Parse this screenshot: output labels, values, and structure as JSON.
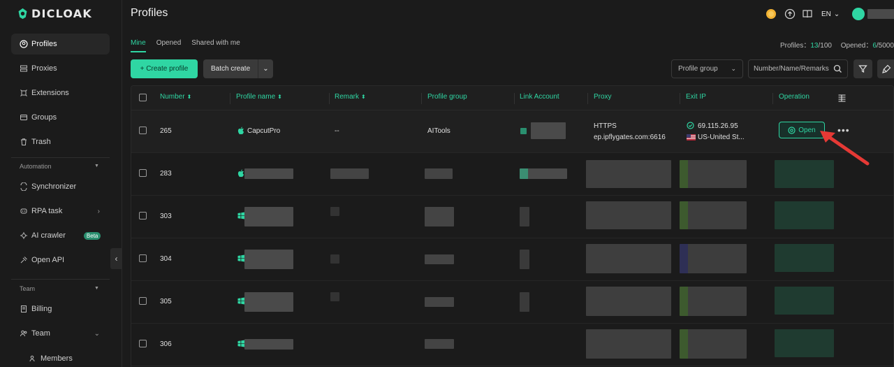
{
  "app": {
    "logo_text": "DICLOAK",
    "page_title": "Profiles"
  },
  "colors": {
    "accent": "#2fd6a3",
    "background": "#1b1b1b",
    "arrow": "#e53935"
  },
  "sidebar": {
    "items": [
      {
        "label": "Profiles",
        "icon": "profile-icon",
        "active": true
      },
      {
        "label": "Proxies",
        "icon": "proxy-icon"
      },
      {
        "label": "Extensions",
        "icon": "extension-icon"
      },
      {
        "label": "Groups",
        "icon": "groups-icon"
      },
      {
        "label": "Trash",
        "icon": "trash-icon"
      }
    ],
    "automation_label": "Automation",
    "automation_items": [
      {
        "label": "Synchronizer",
        "icon": "sync-icon"
      },
      {
        "label": "RPA task",
        "icon": "rpa-icon"
      },
      {
        "label": "AI crawler",
        "icon": "crawler-icon",
        "badge": "Beta"
      },
      {
        "label": "Open API",
        "icon": "api-icon"
      }
    ],
    "team_label": "Team",
    "team_items": [
      {
        "label": "Billing",
        "icon": "billing-icon"
      },
      {
        "label": "Team",
        "icon": "team-icon"
      },
      {
        "label": "Members",
        "icon": "members-icon"
      }
    ]
  },
  "header": {
    "lang": "EN"
  },
  "tabs": [
    {
      "label": "Mine",
      "active": true
    },
    {
      "label": "Opened"
    },
    {
      "label": "Shared with me"
    }
  ],
  "stats": {
    "profiles_label": "Profiles：",
    "profiles_used": "13",
    "profiles_total": "/100",
    "opened_label": "Opened：",
    "opened_used": "6",
    "opened_total": "/50000"
  },
  "toolbar": {
    "create_label": "+ Create profile",
    "batch_label": "Batch create",
    "group_select": "Profile group",
    "search_placeholder": "Number/Name/Remarks"
  },
  "table": {
    "columns": [
      "Number",
      "Profile name",
      "Remark",
      "Profile group",
      "Link Account",
      "Proxy",
      "Exit IP",
      "Operation"
    ],
    "rows": [
      {
        "number": "265",
        "name": "CapcutPro",
        "os": "apple-icon",
        "remark": "--",
        "group": "AITools",
        "proxy_type": "HTTPS",
        "proxy_host": "ep.ipflygates.com:6616",
        "exit_ip": "69.115.26.95",
        "country": "US-United St...",
        "action": "Open"
      },
      {
        "number": "283",
        "os": "apple-icon"
      },
      {
        "number": "303",
        "os": "windows-icon"
      },
      {
        "number": "304",
        "os": "windows-icon"
      },
      {
        "number": "305",
        "os": "windows-icon"
      },
      {
        "number": "306",
        "os": "windows-icon"
      }
    ]
  }
}
